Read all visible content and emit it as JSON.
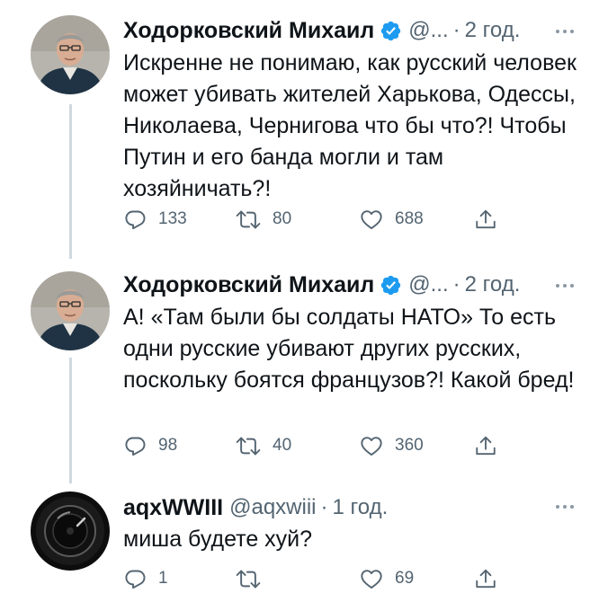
{
  "tweets": [
    {
      "author_name": "Ходорковский Михаил",
      "handle": "@...",
      "time": "2 год.",
      "text": "Искренне не понимаю, как русский человек может убивать жителей Харькова, Одессы, Николаева, Чернигова что бы что?! Чтобы Путин и его банда могли и там хозяйничать?!",
      "replies": "133",
      "retweets": "80",
      "likes": "688"
    },
    {
      "author_name": "Ходорковский Михаил",
      "handle": "@...",
      "time": "2 год.",
      "text": "А! «Там были бы солдаты НАТО» То есть одни русские убивают других русских, поскольку боятся французов?! Какой бред!",
      "replies": "98",
      "retweets": "40",
      "likes": "360"
    },
    {
      "author_name": "aqxWWIII",
      "handle": "@aqxwiii",
      "time": "1 год.",
      "text": "миша будете хуй?",
      "replies": "1",
      "retweets": "",
      "likes": "69"
    }
  ],
  "separator": "·",
  "colors": {
    "verified_badge": "#1d9bf0",
    "secondary_text": "#536471",
    "thread_line": "#cfd9de"
  },
  "icons": [
    "reply-icon",
    "retweet-icon",
    "like-icon",
    "share-icon",
    "verified-badge-icon",
    "more-icon"
  ]
}
